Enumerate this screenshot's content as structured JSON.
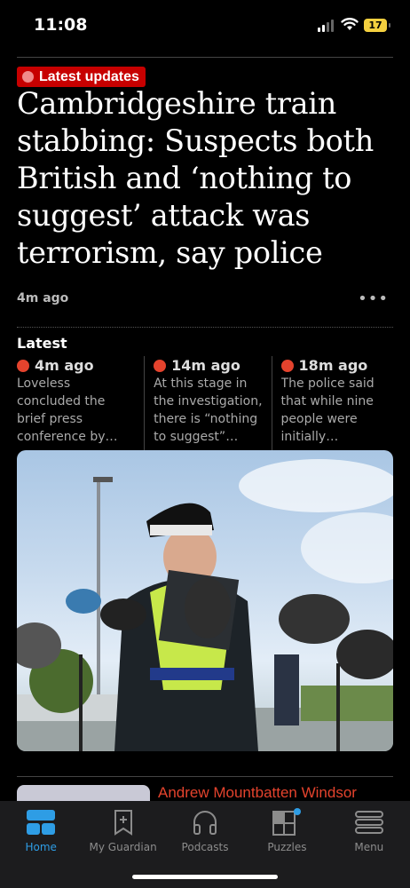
{
  "status": {
    "time": "11:08",
    "battery": "17"
  },
  "article": {
    "badge": "Latest updates",
    "headline": "Cambridgeshire train stabbing: Suspects both British and ‘nothing to suggest’ attack was terrorism, say police",
    "time": "4m ago",
    "more_label": "•••"
  },
  "latest": {
    "label": "Latest",
    "items": [
      {
        "time": "4m ago",
        "text": "Loveless concluded the brief press conference by saying…"
      },
      {
        "time": "14m ago",
        "text": "At this stage in the investigation, there is “nothing to suggest” that…"
      },
      {
        "time": "18m ago",
        "text": "The police said that while nine people were initially believed…"
      }
    ]
  },
  "next_story": {
    "title": "Andrew Mountbatten Windsor"
  },
  "tabs": [
    {
      "label": "Home",
      "icon": "home-icon",
      "active": true
    },
    {
      "label": "My Guardian",
      "icon": "bookmark-icon",
      "active": false
    },
    {
      "label": "Podcasts",
      "icon": "headphones-icon",
      "active": false
    },
    {
      "label": "Puzzles",
      "icon": "puzzle-icon",
      "active": false
    },
    {
      "label": "Menu",
      "icon": "menu-icon",
      "active": false
    }
  ],
  "colors": {
    "accent_red": "#c70000",
    "live_dot": "#e4432d",
    "tab_active": "#2e9de5",
    "background": "#000000"
  }
}
